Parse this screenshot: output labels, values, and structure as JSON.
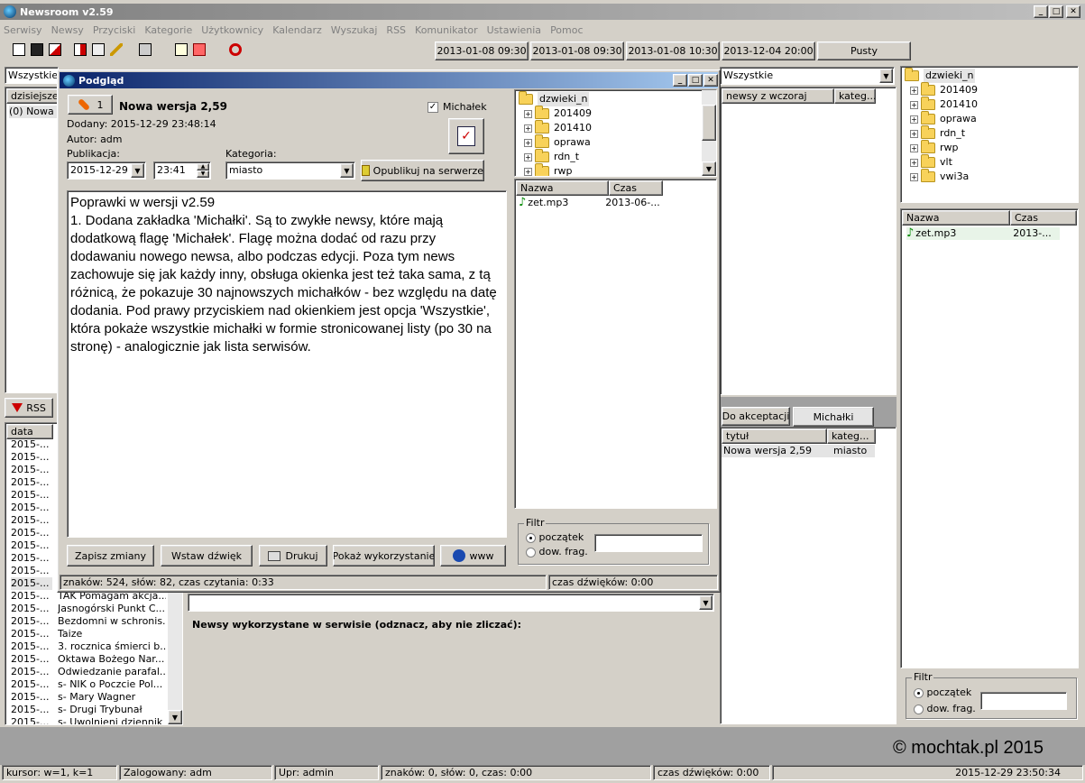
{
  "app": {
    "title": "Newsroom v2.59"
  },
  "colors": {
    "titlebar": "#0a246a",
    "titlebar_end": "#a6caf0",
    "inactive_title": "#808080",
    "selection": "#e4e4e4"
  },
  "menu": [
    "Serwisy",
    "Newsy",
    "Przyciski",
    "Kategorie",
    "Użytkownicy",
    "Kalendarz",
    "Wyszukaj",
    "RSS",
    "Komunikator",
    "Ustawienia",
    "Pomoc"
  ],
  "toolbar": {
    "icons": [
      "new-document-icon",
      "save-icon",
      "copy-icon",
      "export-icon",
      "edit-icon",
      "pencil-icon",
      "print-icon",
      "page-icon",
      "erase-icon",
      "refresh-icon"
    ],
    "times": [
      "2013-01-08 09:30",
      "2013-01-08 09:30",
      "2013-01-08 10:30",
      "2013-12-04 20:00",
      "Pusty"
    ]
  },
  "left": {
    "combo": "Wszystkie",
    "col_header": "dzisiejsze n",
    "row": "(0) Nowa w",
    "rss_button": "RSS",
    "list_header": "data",
    "dates": [
      "2015-...",
      "2015-...",
      "2015-...",
      "2015-...",
      "2015-...",
      "2015-...",
      "2015-...",
      "2015-...",
      "2015-...",
      "2015-...",
      "2015-...",
      "2015-...",
      "2015-...",
      "2015-...",
      "2015-...",
      "2015-...",
      "2015-...",
      "2015-...",
      "2015-...",
      "2015-...",
      "2015-...",
      "2015-...",
      "2015-..."
    ],
    "titles": [
      "TAK Pomagam akcja...",
      "Jasnogórski Punkt C...",
      "Bezdomni w schronis...",
      "Taize",
      "3. rocznica śmierci b...",
      "Oktawa Bożego Nar...",
      "Odwiedzanie parafal...",
      "s- NIK o Poczcie Pol...",
      "s- Mary Wagner",
      "s- Drugi Trybunał",
      "s- Uwolnieni dziennik"
    ]
  },
  "middle_right": {
    "combo": "Wszystkie",
    "headers": [
      "newsy z wczoraj",
      "kateg..."
    ],
    "tabs": [
      "Do akceptacji",
      "Michałki"
    ],
    "list_headers": [
      "tytuł",
      "kateg..."
    ],
    "row": {
      "title": "Nowa wersja 2,59",
      "category": "miasto"
    }
  },
  "bottom_center": {
    "label": "Newsy wykorzystane w serwisie (odznacz, aby nie zliczać):"
  },
  "right": {
    "tree": {
      "root": "dzwieki_n",
      "children": [
        "201409",
        "201410",
        "oprawa",
        "rdn_t",
        "rwp",
        "vlt",
        "vwi3a"
      ]
    },
    "file_headers": [
      "Nazwa",
      "Czas"
    ],
    "file": {
      "name": "zet.mp3",
      "time": "2013-..."
    },
    "filter": {
      "title": "Filtr",
      "opt1": "początek",
      "opt2": "dow. frag."
    },
    "watermark": "© mochtak.pl 2015"
  },
  "dialog": {
    "title": "Podgląd",
    "counter": "1",
    "heading": "Nowa wersja 2,59",
    "added": "Dodany: 2015-12-29 23:48:14",
    "author": "Autor: adm",
    "michalek_label": "Michałek",
    "publication_label": "Publikacja:",
    "date": "2015-12-29",
    "time": "23:41",
    "category_label": "Kategoria:",
    "category": "miasto",
    "publish_button": "Opublikuj na serwerze",
    "text": "Poprawki w wersji v2.59\n1. Dodana zakładka 'Michałki'. Są to zwykłe newsy, które mają dodatkową flagę 'Michałek'. Flagę można dodać od razu przy dodawaniu nowego newsa, albo podczas edycji. Poza tym news zachowuje się jak każdy inny, obsługa okienka jest też taka sama, z tą różnicą, że pokazuje 30 najnowszych michałków - bez względu na datę dodania. Pod prawy przyciskiem nad okienkiem jest opcja 'Wszystkie', która pokaże wszystkie michałki w formie stronicowanej listy (po 30 na stronę) - analogicznie jak lista serwisów.",
    "buttons": {
      "save": "Zapisz zmiany",
      "sound": "Wstaw dźwięk",
      "print": "Drukuj",
      "usage": "Pokaż wykorzystanie",
      "www": "www"
    },
    "tree": {
      "root": "dzwieki_n",
      "children": [
        "201409",
        "201410",
        "oprawa",
        "rdn_t",
        "rwp"
      ]
    },
    "file_headers": [
      "Nazwa",
      "Czas"
    ],
    "file": {
      "name": "zet.mp3",
      "time": "2013-06-..."
    },
    "filter": {
      "title": "Filtr",
      "opt1": "początek",
      "opt2": "dow. frag."
    },
    "status": {
      "counts": "znaków: 524, słów: 82, czas czytania: 0:33",
      "sound": "czas dźwięków: 0:00"
    }
  },
  "statusbar": [
    "kursor: w=1, k=1",
    "Zalogowany: adm",
    "Upr: admin",
    "znaków: 0, słów: 0, czas: 0:00",
    "czas dźwięków: 0:00",
    "2015-12-29 23:50:34"
  ]
}
